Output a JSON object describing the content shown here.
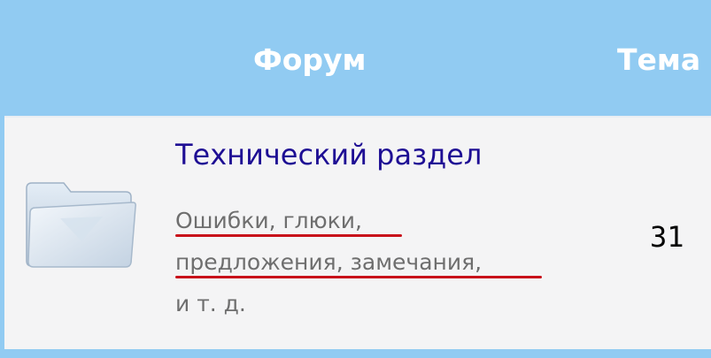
{
  "header": {
    "forum_column": "Форум",
    "topics_column": "Тема"
  },
  "forum_row": {
    "title": "Технический раздел",
    "description_lines": [
      "Ошибки, глюки,",
      "предложения, замечания,",
      "и т. д."
    ],
    "topics_count": "31",
    "icon": "folder-icon"
  },
  "colors": {
    "header_bg": "#91cbf2",
    "title_link": "#1e0e94",
    "description_text": "#6e6e6e",
    "annotation_underline": "#c8101a"
  }
}
